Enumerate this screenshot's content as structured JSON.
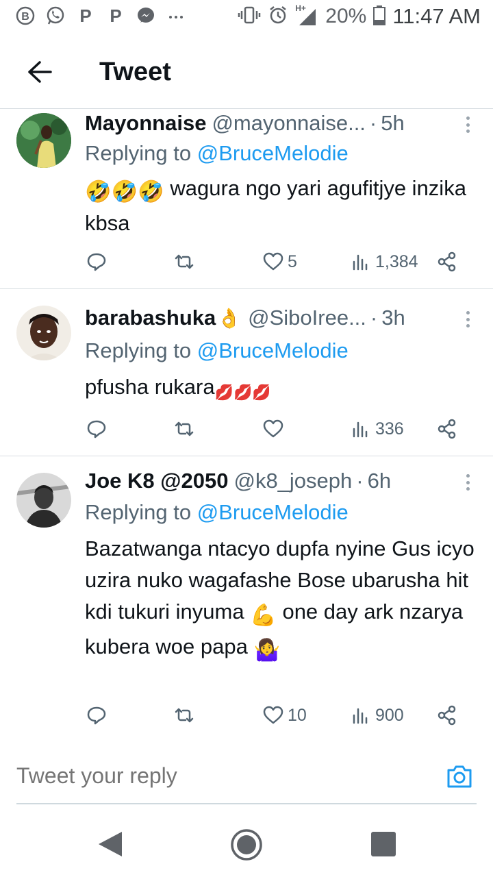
{
  "status_bar": {
    "left_icons": [
      "bbm-icon",
      "whatsapp-icon",
      "pinterest-icon",
      "pinterest-icon",
      "messenger-icon",
      "more-dots-icon"
    ],
    "battery": "20%",
    "time": "11:47 AM",
    "network": "H+"
  },
  "header": {
    "title": "Tweet"
  },
  "tweets": [
    {
      "name": "Mayonnaise",
      "handle": "@mayonnaise...",
      "time": "5h",
      "replying_label": "Replying to",
      "replying_to": "@BruceMelodie",
      "text_emoji": "🤣🤣🤣",
      "text": "wagura ngo yari agufitjye inzika kbsa",
      "likes": "5",
      "views": "1,384"
    },
    {
      "name": "barabashuka",
      "name_emoji": "👌",
      "handle": "@SiboIree...",
      "time": "3h",
      "replying_label": "Replying to",
      "replying_to": "@BruceMelodie",
      "text": "pfusha rukara",
      "text_emoji": "💋💋💋",
      "likes": "",
      "views": "336"
    },
    {
      "name": "Joe K8 @2050",
      "handle": "@k8_joseph",
      "time": "6h",
      "replying_label": "Replying to",
      "replying_to": "@BruceMelodie",
      "text": "Bazatwanga ntacyo dupfa nyine Gus icyo uzira nuko wagafashe Bose ubarusha hit kdi tukuri inyuma",
      "text_emoji_1": "💪",
      "text_2": "one day ark nzarya kubera woe papa",
      "text_emoji_2": "🤷‍♀️",
      "likes": "10",
      "views": "900"
    }
  ],
  "reply_box": {
    "placeholder": "Tweet your reply"
  },
  "colors": {
    "link": "#1d9bf0",
    "secondary": "#536471",
    "text": "#0f1419"
  }
}
